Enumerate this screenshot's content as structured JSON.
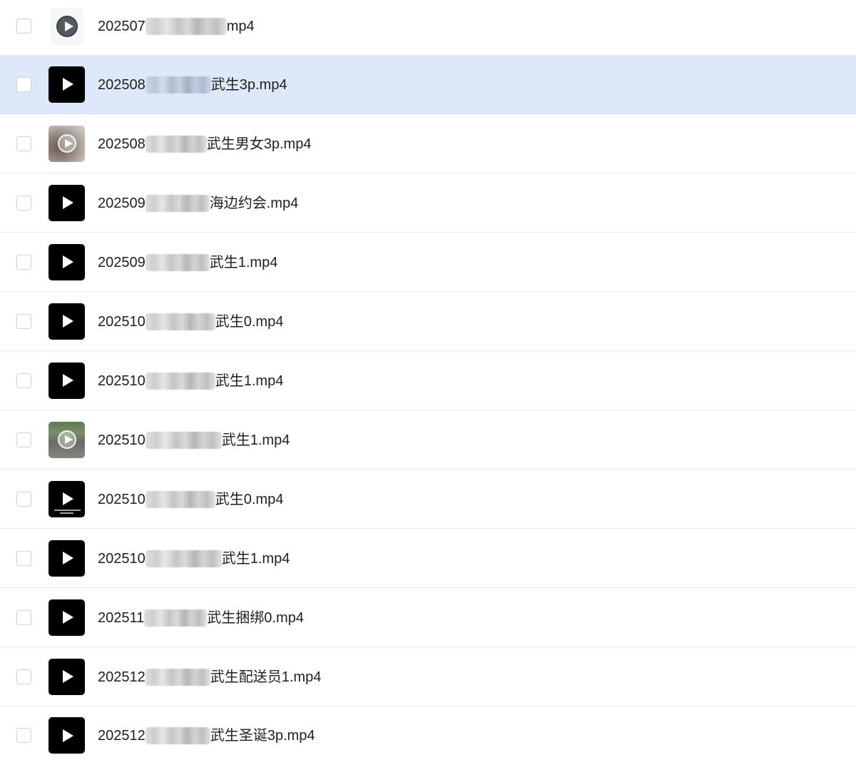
{
  "files": [
    {
      "name_start": "202507",
      "name_end": "mp4",
      "thumb": "generic-video-icon",
      "selected": false
    },
    {
      "name_start": "202508",
      "name_end": "武生3p.mp4",
      "thumb": "play-icon",
      "selected": true
    },
    {
      "name_start": "202508",
      "name_end": "武生男女3p.mp4",
      "thumb": "photo-thumbnail",
      "selected": false
    },
    {
      "name_start": "202509",
      "name_end": "海边约会.mp4",
      "thumb": "play-icon",
      "selected": false
    },
    {
      "name_start": "202509",
      "name_end": "武生1.mp4",
      "thumb": "play-icon",
      "selected": false
    },
    {
      "name_start": "202510",
      "name_end": "武生0.mp4",
      "thumb": "play-icon",
      "selected": false
    },
    {
      "name_start": "202510",
      "name_end": "武生1.mp4",
      "thumb": "play-icon",
      "selected": false
    },
    {
      "name_start": "202510",
      "name_end": "武生1.mp4",
      "thumb": "photo-thumbnail",
      "selected": false
    },
    {
      "name_start": "202510",
      "name_end": "武生0.mp4",
      "thumb": "caption-thumbnail",
      "selected": false
    },
    {
      "name_start": "202510",
      "name_end": "武生1.mp4",
      "thumb": "play-icon",
      "selected": false
    },
    {
      "name_start": "202511",
      "name_end": "武生捆绑0.mp4",
      "thumb": "play-icon",
      "selected": false
    },
    {
      "name_start": "202512",
      "name_end": "武生配送员1.mp4",
      "thumb": "play-icon",
      "selected": false
    },
    {
      "name_start": "202512",
      "name_end": "武生圣诞3p.mp4",
      "thumb": "play-icon",
      "selected": false
    }
  ],
  "colors": {
    "selected_row_background": "#dde9fb",
    "row_divider": "#e9e9ee",
    "thumbnail_background": "#000000",
    "text": "#1f1f1f"
  }
}
